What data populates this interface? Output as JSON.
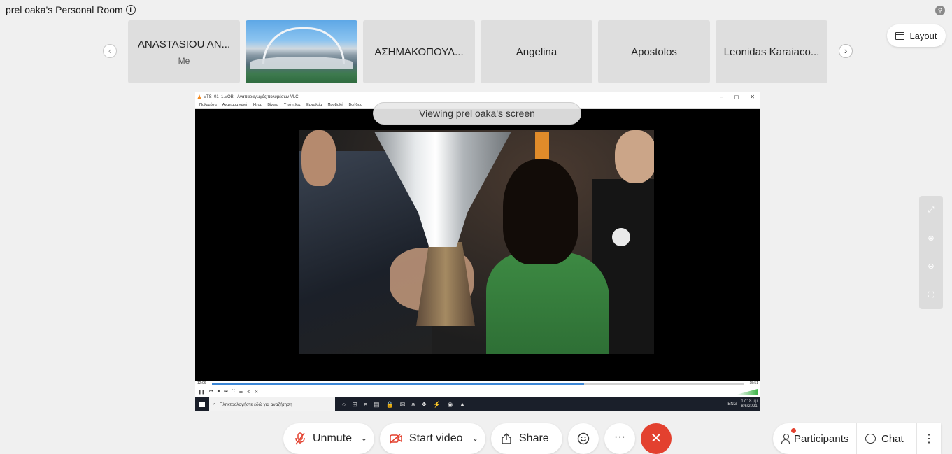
{
  "header": {
    "room_title": "prel oaka's Personal Room",
    "info_glyph": "i",
    "top_right_glyph": "⚲"
  },
  "gallery": {
    "prev_glyph": "‹",
    "next_glyph": "›",
    "tiles": [
      {
        "name": "ANASTASIOU AN...",
        "sub": "Me"
      },
      {
        "name": "",
        "sub": "",
        "image": "stadium-photo"
      },
      {
        "name": "ΑΣΗΜΑΚΟΠΟΥΛ...",
        "sub": ""
      },
      {
        "name": "Angelina",
        "sub": ""
      },
      {
        "name": "Apostolos",
        "sub": ""
      },
      {
        "name": "Leonidas Karaiaco...",
        "sub": ""
      }
    ]
  },
  "layout_button": {
    "label": "Layout"
  },
  "shared_screen": {
    "banner": "Viewing prel oaka's screen",
    "vlc_title": "VTS_01_1.VOB - Αναπαραγωγός πολυμέσων VLC",
    "window_controls": [
      "–",
      "◻",
      "✕"
    ],
    "menu_items": [
      "Πολυμέσα",
      "Αναπαραγωγή",
      "Ήχος",
      "Βίντεο",
      "Υπότιτλος",
      "Εργαλεία",
      "Προβολή",
      "Βοήθεια"
    ],
    "time_elapsed": "12:06",
    "time_total": "15:51",
    "progress": 0.7,
    "controls": [
      "❚❚",
      "⏮",
      "■",
      "⏭",
      "⛶",
      "☰",
      "⟲",
      "✕"
    ],
    "taskbar": {
      "search_placeholder": "Πληκτρολογήστε εδώ για αναζήτηση",
      "icons": [
        "○",
        "⊞",
        "e",
        "▤",
        "🔒",
        "✉",
        "a",
        "❖",
        "⚡",
        "◉",
        "▲"
      ],
      "lang": "ENG",
      "clock_time": "17:18 μμ",
      "clock_date": "8/6/2021"
    }
  },
  "side_toolbar": {
    "icons": [
      "⤢",
      "⊕",
      "⊖",
      "⛶"
    ]
  },
  "controls": {
    "unmute_label": "Unmute",
    "start_video_label": "Start video",
    "share_label": "Share",
    "more_glyph": "···",
    "end_glyph": "✕",
    "chevron": "⌄"
  },
  "right_group": {
    "participants_label": "Participants",
    "chat_label": "Chat",
    "more_glyph": "⋮"
  },
  "colors": {
    "accent_red": "#e3412f",
    "progress_blue": "#3d87d6",
    "background": "#f0f0f0"
  }
}
